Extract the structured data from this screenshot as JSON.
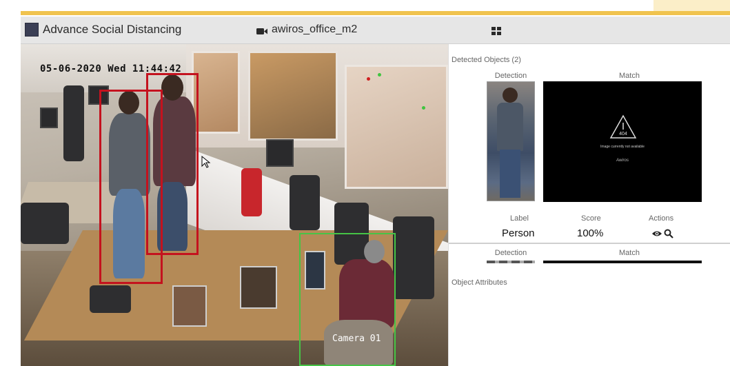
{
  "app": {
    "title": "Advance Social Distancing",
    "camera_name": "awiros_office_m2"
  },
  "video": {
    "timestamp": "05-06-2020 Wed 11:44:42",
    "camera_label": "Camera 01"
  },
  "panel": {
    "detected_title": "Detected Objects (2)",
    "col_detection": "Detection",
    "col_match": "Match",
    "match_placeholder_text": "Image currently not available",
    "match_placeholder_code": "404",
    "match_brand": "Awiros",
    "hdr_label": "Label",
    "hdr_score": "Score",
    "hdr_actions": "Actions",
    "label_value": "Person",
    "score_value": "100%",
    "col_detection2": "Detection",
    "col_match2": "Match",
    "attributes_title": "Object Attributes"
  },
  "colors": {
    "accent_gold": "#f0c34e",
    "bbox_alert": "#c4121e",
    "bbox_ok": "#46c446"
  },
  "icons": [
    "app-logo-icon",
    "video-camera-icon",
    "grid-icon",
    "warning-icon",
    "eye-icon",
    "search-icon"
  ]
}
